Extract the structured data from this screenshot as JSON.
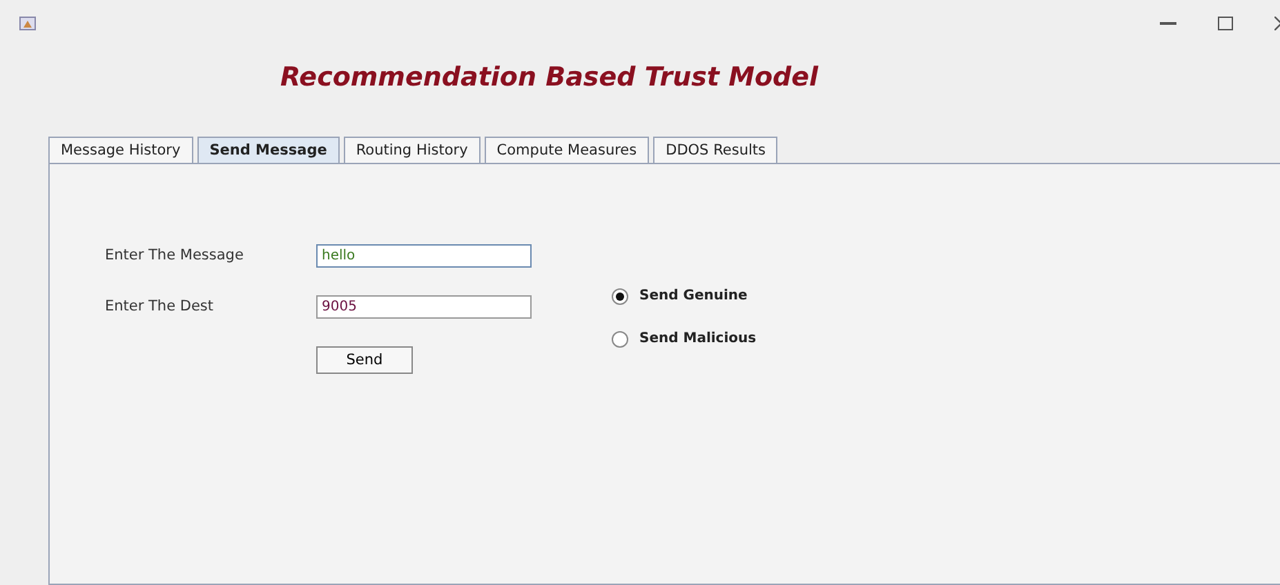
{
  "window": {
    "title": "Recommendation Based Trust Model"
  },
  "tabs": [
    {
      "label": "Message History",
      "selected": false
    },
    {
      "label": "Send Message",
      "selected": true
    },
    {
      "label": "Routing History",
      "selected": false
    },
    {
      "label": "Compute Measures",
      "selected": false
    },
    {
      "label": "DDOS Results",
      "selected": false
    }
  ],
  "form": {
    "fields": [
      {
        "label": "Enter The Message",
        "value": "hello",
        "focused": true
      },
      {
        "label": "Enter The Dest",
        "value": "9005",
        "focused": false
      }
    ],
    "options": [
      {
        "label": "Send Genuine",
        "selected": true
      },
      {
        "label": "Send Malicious",
        "selected": false
      }
    ],
    "button": "Send"
  }
}
